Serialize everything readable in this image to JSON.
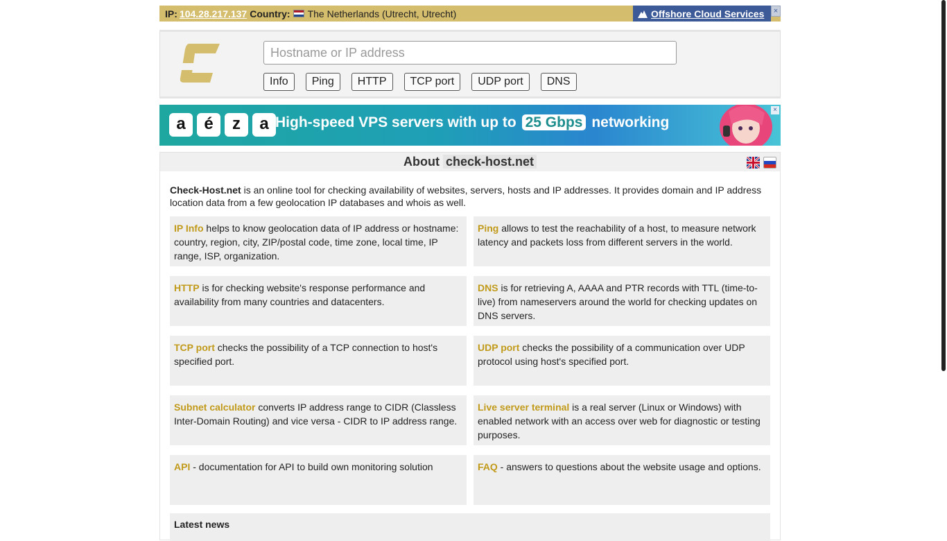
{
  "topbar": {
    "ip_label": "IP",
    "ip_value": "104.28.217.137",
    "country_label": "Country",
    "country_value": "The Netherlands (Utrecht, Utrecht)",
    "offshore_link": "Offshore Cloud Services",
    "close_glyph": "×"
  },
  "search": {
    "placeholder": "Hostname or IP address",
    "buttons": [
      "Info",
      "Ping",
      "HTTP",
      "TCP port",
      "UDP port",
      "DNS"
    ]
  },
  "banner": {
    "brand_letters": [
      "a",
      "é",
      "z",
      "a"
    ],
    "text_before": "High-speed VPS servers with up to",
    "highlight": "25 Gbps",
    "text_after": "networking",
    "close_glyph": "×"
  },
  "about": {
    "title_prefix": "About",
    "title_domain": "check-host.net",
    "intro_bold": "Check-Host.net",
    "intro_text": " is an online tool for checking availability of websites, servers, hosts and IP addresses. It provides domain and IP address location data from a few geolocation IP databases and whois as well.",
    "items": [
      {
        "title": "IP Info",
        "text": " helps to know geolocation data of IP address or hostname: country, region, city, ZIP/postal code, time zone, local time, IP range, ISP, organization."
      },
      {
        "title": "Ping",
        "text": " allows to test the reachability of a host, to measure network latency and packets loss from different servers in the world."
      },
      {
        "title": "HTTP",
        "text": " is for checking website's response performance and availability from many countries and datacenters."
      },
      {
        "title": "DNS",
        "text": " is for retrieving A, AAAA and PTR records with TTL (time-to-live) from nameservers around the world for checking updates on DNS servers."
      },
      {
        "title": "TCP port",
        "text": " checks the possibility of a TCP connection to host's specified port."
      },
      {
        "title": "UDP port",
        "text": " checks the possibility of a communication over UDP protocol using host's specified port."
      },
      {
        "title": "Subnet calculator",
        "text": " converts IP address range to CIDR (Classless Inter-Domain Routing) and vice versa - CIDR to IP address range."
      },
      {
        "title": "Live server terminal",
        "text": " is a real server (Linux or Windows) with enabled network with an access over web for diagnostic or testing purposes."
      },
      {
        "title": "API",
        "text": " - documentation for API to build own monitoring solution"
      },
      {
        "title": "FAQ",
        "text": " - answers to questions about the website usage and options."
      }
    ],
    "news_title": "Latest news"
  },
  "colors": {
    "topbar_bg": "#d4bd6d",
    "accent_gold": "#c19a1a",
    "offshore_bg": "#3d5a98"
  }
}
